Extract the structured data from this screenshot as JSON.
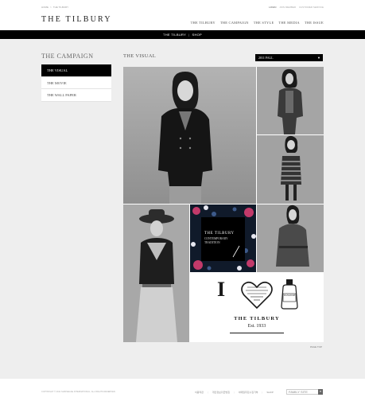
{
  "utility": {
    "breadcrumb_home": "HOME",
    "breadcrumb_sep": ">",
    "breadcrumb_current": "THE TILBURY",
    "login": "LOGIN",
    "join": "JOIN MEMBER",
    "customer": "CUSTOMER SERVICE"
  },
  "header": {
    "logo": "THE TILBURY",
    "nav": [
      "THE TILBURY",
      "THE CAMPAIGN",
      "THE STYLE",
      "THE MEDIA",
      "THE ISSUE"
    ]
  },
  "subbar": {
    "left": "THE TILBURY",
    "sep": "|",
    "right": "SHOP"
  },
  "sidebar": {
    "title": "THE CAMPAIGN",
    "items": [
      "THE VISUAL",
      "THE MOVIE",
      "THE WALL PAPER"
    ]
  },
  "main": {
    "title": "THE VISUAL",
    "season": "2011 FALL",
    "season_arrow": "▼",
    "center_tile": {
      "brand": "THE TILBURY",
      "line1": "CONTEMPORARY",
      "line2": "TRADITION"
    },
    "logo_tile": {
      "letter": "I",
      "bottle_label": "SIGNATURE",
      "name": "THE TILBURY",
      "est": "Est. 1933"
    },
    "to_top": "PAGE TOP"
  },
  "footer": {
    "copyright": "COPYRIGHT © 2011 SHINSEGAE INTERNATIONAL. ALL RIGHTS RESERVED.",
    "links": [
      "이용약관",
      "개인정보취급방침",
      "이메일무단수집거부",
      "SHOP"
    ],
    "family_site": "FAMILY SITE",
    "family_arrow": "▼"
  },
  "colors": {
    "bar": "#000000",
    "content_bg": "#eeeeee",
    "photo_bg": "#9a9a9a"
  }
}
